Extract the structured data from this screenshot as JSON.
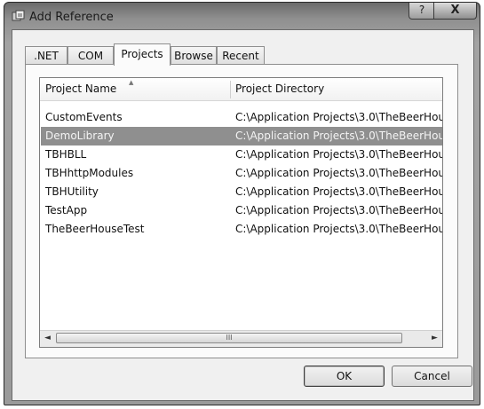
{
  "window": {
    "title": "Add Reference",
    "help_label": "?",
    "close_label": "X"
  },
  "tabs": [
    {
      "label": ".NET"
    },
    {
      "label": "COM"
    },
    {
      "label": "Projects",
      "active": true
    },
    {
      "label": "Browse"
    },
    {
      "label": "Recent"
    }
  ],
  "list": {
    "columns": [
      "Project Name",
      "Project Directory"
    ],
    "rows": [
      {
        "name": "CustomEvents",
        "dir": "C:\\Application Projects\\3.0\\TheBeerHou"
      },
      {
        "name": "DemoLibrary",
        "dir": "C:\\Application Projects\\3.0\\TheBeerHou",
        "selected": true
      },
      {
        "name": "TBHBLL",
        "dir": "C:\\Application Projects\\3.0\\TheBeerHou"
      },
      {
        "name": "TBHhttpModules",
        "dir": "C:\\Application Projects\\3.0\\TheBeerHou"
      },
      {
        "name": "TBHUtility",
        "dir": "C:\\Application Projects\\3.0\\TheBeerHou"
      },
      {
        "name": "TestApp",
        "dir": "C:\\Application Projects\\3.0\\TheBeerHou"
      },
      {
        "name": "TheBeerHouseTest",
        "dir": "C:\\Application Projects\\3.0\\TheBeerHou"
      }
    ],
    "scroll_grip": "III"
  },
  "buttons": {
    "ok": "OK",
    "cancel": "Cancel"
  },
  "icons": {
    "title": "add-reference-icon",
    "sort": "sort-up-icon",
    "scroll_left": "scroll-left-icon",
    "scroll_right": "scroll-right-icon"
  }
}
